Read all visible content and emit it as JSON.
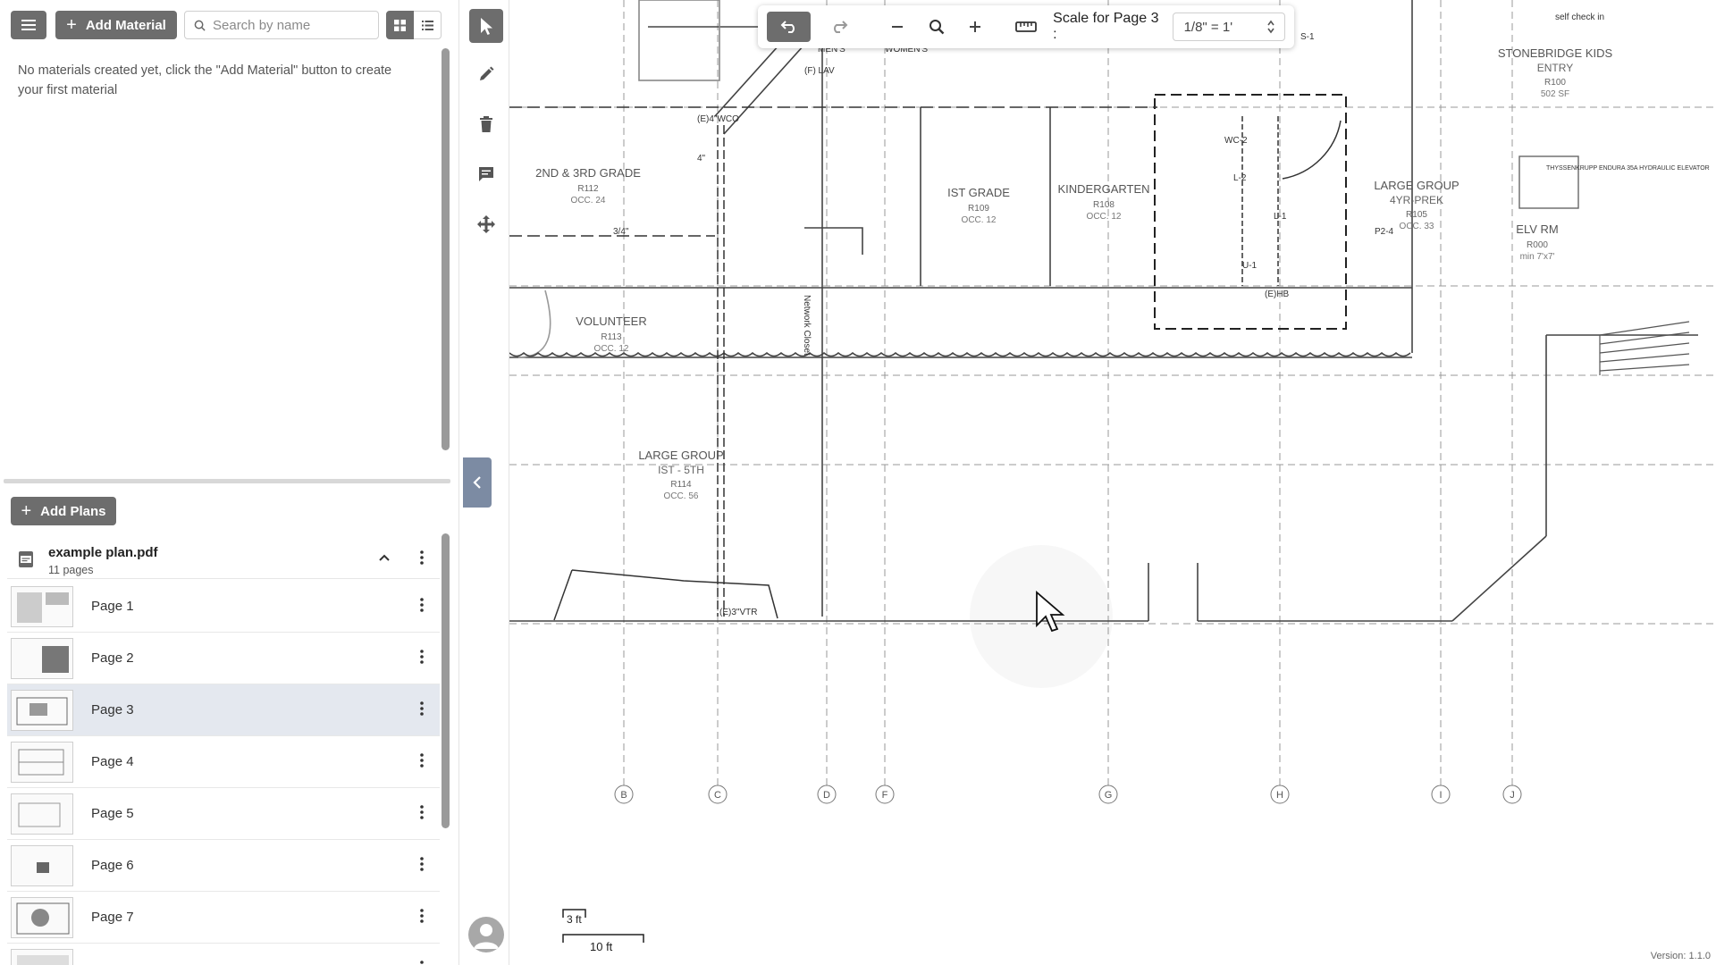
{
  "sidebar": {
    "add_material_label": "Add Material",
    "search_placeholder": "Search by name",
    "empty_message": "No materials created yet, click the \"Add Material\" button to create your first material",
    "add_plans_label": "Add Plans",
    "file": {
      "name": "example plan.pdf",
      "pages": "11 pages"
    },
    "page_list": [
      {
        "label": "Page 1",
        "active": false
      },
      {
        "label": "Page 2",
        "active": false
      },
      {
        "label": "Page 3",
        "active": true
      },
      {
        "label": "Page 4",
        "active": false
      },
      {
        "label": "Page 5",
        "active": false
      },
      {
        "label": "Page 6",
        "active": false
      },
      {
        "label": "Page 7",
        "active": false
      },
      {
        "label": "",
        "active": false
      }
    ]
  },
  "toolbar": {
    "scale_label": "Scale for Page 3 :",
    "scale_value": "1/8\" = 1'"
  },
  "plan": {
    "rooms": [
      {
        "name": "2ND & 3RD GRADE",
        "num": "R112",
        "occ": "OCC. 24"
      },
      {
        "name": "IST GRADE",
        "num": "R109",
        "occ": "OCC. 12"
      },
      {
        "name": "KINDERGARTEN",
        "num": "R108",
        "occ": "OCC. 12"
      },
      {
        "name": "LARGE GROUP",
        "sub": "4YR-PREK",
        "num": "R105",
        "occ": "OCC. 33"
      },
      {
        "name": "VOLUNTEER",
        "num": "R113",
        "occ": "OCC. 12"
      },
      {
        "name": "LARGE GROUP",
        "sub": "IST - 5TH",
        "num": "R114",
        "occ": "OCC. 56"
      },
      {
        "name": "STONEBRIDGE KIDS",
        "sub": "ENTRY",
        "num": "R100",
        "occ": "502 SF"
      },
      {
        "name": "ELV RM",
        "num": "R000",
        "occ": "min 7'x7'"
      }
    ],
    "notes": [
      "(E)4\"WCO",
      "(E)3\"VTR",
      "4\"",
      "3/4\"",
      "(E)HB",
      "WC-2",
      "L-2",
      "U-1",
      "L-1",
      "S-1",
      "P2-4",
      "(F) LAV",
      "MEN'S",
      "WOMEN'S",
      "self check in",
      "THYSSENKRUPP ENDURA 35A HYDRAULIC ELEVATOR",
      "Network Closet"
    ],
    "grid_labels": [
      "B",
      "C",
      "D",
      "F",
      "G",
      "H",
      "I",
      "J"
    ],
    "scale_bar": {
      "small": "3 ft",
      "large": "10 ft"
    }
  },
  "version": "Version: 1.1.0"
}
